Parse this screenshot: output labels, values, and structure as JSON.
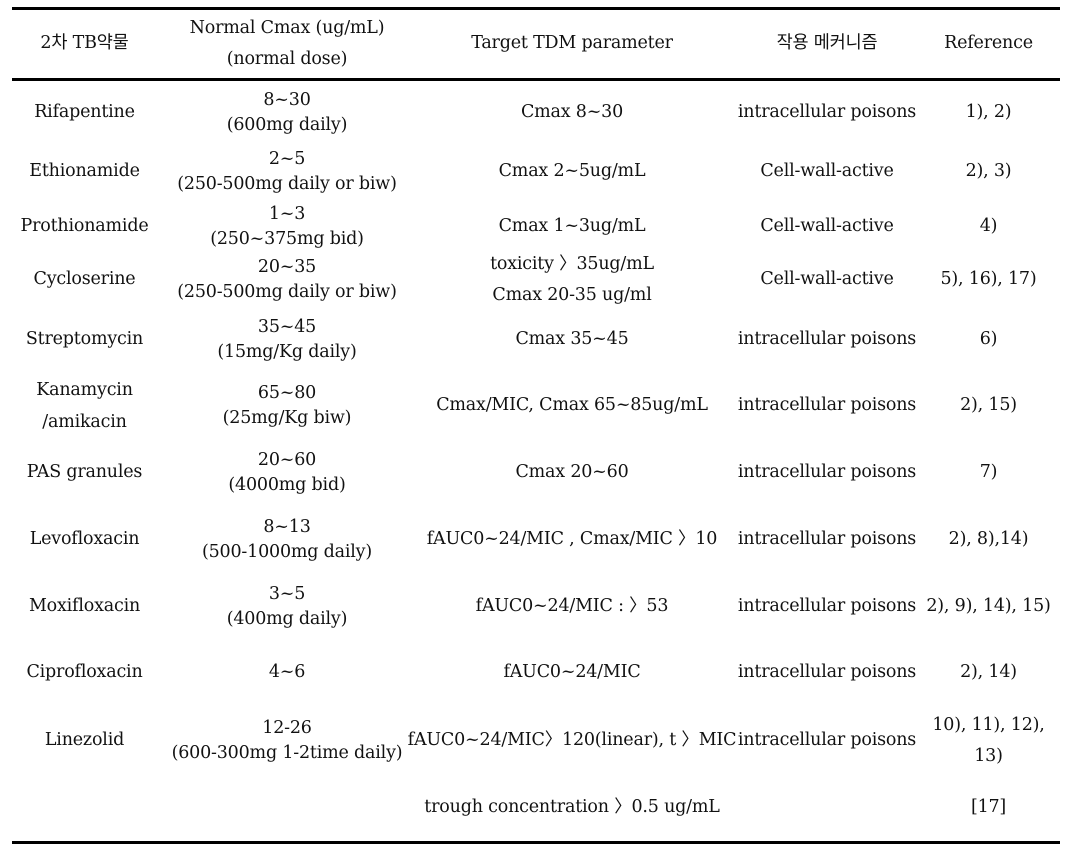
{
  "table": {
    "headers": [
      "2차 TB약물",
      [
        "Normal Cmax (ug/mL)",
        "(normal dose)"
      ],
      "Target TDM parameter",
      "작용 메커니즘",
      "Reference"
    ],
    "rows": [
      {
        "drug": [
          "Rifapentine"
        ],
        "cmax": "8~30",
        "dose": "(600mg daily)",
        "target": [
          "Cmax 8~30"
        ],
        "mechanism": "intracellular poisons",
        "reference": [
          "1), 2)"
        ]
      },
      {
        "drug": [
          "Ethionamide"
        ],
        "cmax": "2~5",
        "dose": "(250-500mg daily or biw)",
        "target": [
          "Cmax 2~5ug/mL"
        ],
        "mechanism": "Cell-wall-active",
        "reference": [
          "2), 3)"
        ]
      },
      {
        "drug": [
          "Prothionamide"
        ],
        "cmax": "1~3",
        "dose": "(250~375mg bid)",
        "target": [
          "Cmax 1~3ug/mL"
        ],
        "mechanism": "Cell-wall-active",
        "reference": [
          "4)"
        ]
      },
      {
        "drug": [
          "Cycloserine"
        ],
        "cmax": "20~35",
        "dose": "(250-500mg daily or biw)",
        "target": [
          "toxicity 〉35ug/mL",
          "Cmax 20-35 ug/ml"
        ],
        "mechanism": "Cell-wall-active",
        "reference": [
          "5), 16), 17)"
        ]
      },
      {
        "drug": [
          "Streptomycin"
        ],
        "cmax": "35~45",
        "dose": "(15mg/Kg daily)",
        "target": [
          "Cmax 35~45"
        ],
        "mechanism": "intracellular poisons",
        "reference": [
          "6)"
        ]
      },
      {
        "drug": [
          "Kanamycin",
          "/amikacin"
        ],
        "cmax": "65~80",
        "dose": "(25mg/Kg biw)",
        "target": [
          "Cmax/MIC, Cmax 65~85ug/mL"
        ],
        "mechanism": "intracellular poisons",
        "reference": [
          "2), 15)"
        ]
      },
      {
        "drug": [
          "PAS granules"
        ],
        "cmax": "20~60",
        "dose": "(4000mg bid)",
        "target": [
          "Cmax 20~60"
        ],
        "mechanism": "intracellular poisons",
        "reference": [
          "7)"
        ]
      },
      {
        "drug": [
          "Levofloxacin"
        ],
        "cmax": "8~13",
        "dose": "(500-1000mg daily)",
        "target": [
          "fAUC0~24/MIC , Cmax/MIC 〉10"
        ],
        "mechanism": "intracellular poisons",
        "reference": [
          "2), 8),14)"
        ]
      },
      {
        "drug": [
          "Moxifloxacin"
        ],
        "cmax": "3~5",
        "dose": "(400mg daily)",
        "target": [
          "fAUC0~24/MIC : 〉53"
        ],
        "mechanism": "intracellular poisons",
        "reference": [
          "2), 9), 14), 15)"
        ]
      },
      {
        "drug": [
          "Ciprofloxacin"
        ],
        "cmax": "4~6",
        "dose": "",
        "target": [
          "fAUC0~24/MIC"
        ],
        "mechanism": "intracellular poisons",
        "reference": [
          "2), 14)"
        ]
      },
      {
        "drug": [
          "Linezolid"
        ],
        "cmax": "12-26",
        "dose": "(600-300mg 1-2time daily)",
        "target": [
          "fAUC0~24/MIC〉120(linear), t 〉MIC"
        ],
        "mechanism": "intracellular poisons",
        "reference": [
          "10), 11), 12),",
          "13)"
        ]
      },
      {
        "drug": [
          ""
        ],
        "cmax": "",
        "dose": "",
        "target": [
          "trough concentration 〉0.5 ug/mL"
        ],
        "mechanism": "",
        "reference": [
          "[17]"
        ]
      }
    ]
  }
}
